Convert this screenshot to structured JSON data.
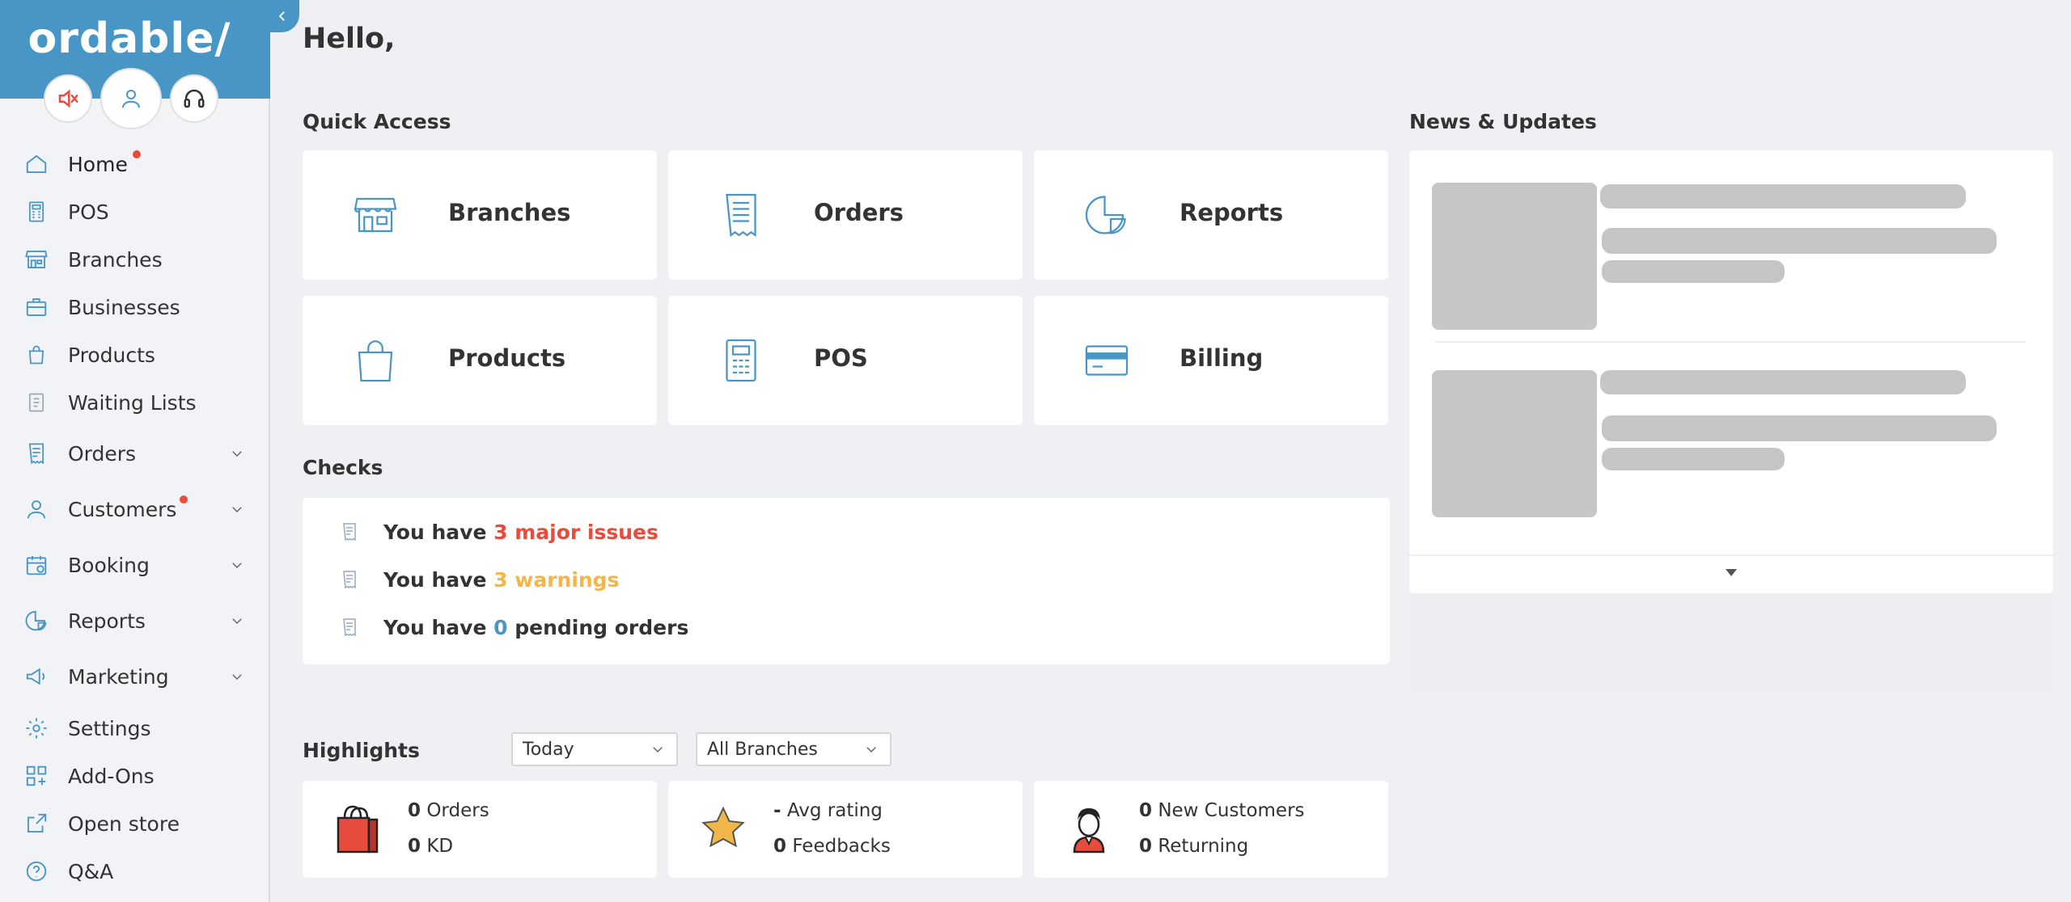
{
  "brand": {
    "logo": "ordable/"
  },
  "sidebar": {
    "items": [
      {
        "label": "Home",
        "icon": "home-icon",
        "has_dot": true
      },
      {
        "label": "POS",
        "icon": "calculator-icon"
      },
      {
        "label": "Branches",
        "icon": "store-icon"
      },
      {
        "label": "Businesses",
        "icon": "briefcase-icon"
      },
      {
        "label": "Products",
        "icon": "shopping-bag-icon"
      },
      {
        "label": "Waiting Lists",
        "icon": "clipboard-icon"
      },
      {
        "label": "Orders",
        "icon": "receipt-icon",
        "expandable": true
      },
      {
        "label": "Customers",
        "icon": "user-icon",
        "expandable": true,
        "has_dot": true
      },
      {
        "label": "Booking",
        "icon": "calendar-icon",
        "expandable": true
      },
      {
        "label": "Reports",
        "icon": "pie-chart-icon",
        "expandable": true
      },
      {
        "label": "Marketing",
        "icon": "megaphone-icon",
        "expandable": true
      },
      {
        "label": "Settings",
        "icon": "gear-icon"
      },
      {
        "label": "Add-Ons",
        "icon": "grid-plus-icon"
      },
      {
        "label": "Open store",
        "icon": "external-link-icon"
      },
      {
        "label": "Q&A",
        "icon": "help-circle-icon"
      }
    ]
  },
  "main": {
    "greeting": "Hello,",
    "quick_access": {
      "title": "Quick Access",
      "cards": [
        {
          "label": "Branches",
          "icon": "store-icon"
        },
        {
          "label": "Orders",
          "icon": "receipt-icon"
        },
        {
          "label": "Reports",
          "icon": "pie-chart-icon"
        },
        {
          "label": "Products",
          "icon": "shopping-bag-icon"
        },
        {
          "label": "POS",
          "icon": "calculator-icon"
        },
        {
          "label": "Billing",
          "icon": "credit-card-icon"
        }
      ]
    },
    "checks": {
      "title": "Checks",
      "prefix": "You have",
      "items": [
        {
          "value": "3 major issues",
          "suffix": "",
          "color": "#e84c3d"
        },
        {
          "value": "3 warnings",
          "suffix": "",
          "color": "#f2b64b"
        },
        {
          "value": "0",
          "suffix": "pending orders",
          "color": "#4896c5"
        }
      ]
    },
    "news": {
      "title": "News & Updates"
    },
    "highlights": {
      "title": "Highlights",
      "period": "Today",
      "branch": "All Branches",
      "cards": [
        {
          "icon": "shopping-bag-icon",
          "lines": [
            {
              "value": "0",
              "label": "Orders"
            },
            {
              "value": "0",
              "label": "KD"
            }
          ]
        },
        {
          "icon": "star-icon",
          "lines": [
            {
              "value": "-",
              "label": "Avg rating"
            },
            {
              "value": "0",
              "label": "Feedbacks"
            }
          ]
        },
        {
          "icon": "customer-avatar-icon",
          "lines": [
            {
              "value": "0",
              "label": "New Customers"
            },
            {
              "value": "0",
              "label": "Returning"
            }
          ]
        }
      ]
    }
  },
  "colors": {
    "brand": "#4896c5",
    "danger": "#e84c3d",
    "warning": "#f2b64b",
    "background": "#eff0f4"
  }
}
